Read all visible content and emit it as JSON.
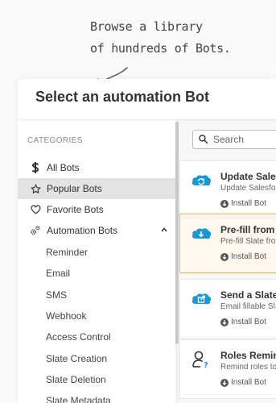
{
  "annotation": {
    "line1": "Browse a library",
    "line2": "of hundreds of Bots."
  },
  "modal": {
    "title": "Select an automation Bot"
  },
  "sidebar": {
    "categories_label": "CATEGORIES",
    "items": [
      {
        "label": "All Bots",
        "icon": "dollar-icon",
        "selected": false
      },
      {
        "label": "Popular Bots",
        "icon": "star-icon",
        "selected": true
      },
      {
        "label": "Favorite Bots",
        "icon": "heart-icon",
        "selected": false
      },
      {
        "label": "Automation Bots",
        "icon": "gears-icon",
        "selected": false,
        "expanded": true
      }
    ],
    "subitems": [
      "Reminder",
      "Email",
      "SMS",
      "Webhook",
      "Access Control",
      "Slate Creation",
      "Slate Deletion",
      "Slate Metadata"
    ]
  },
  "search": {
    "placeholder": "Search",
    "value": ""
  },
  "bots": [
    {
      "title": "Update Sales",
      "description": "Update Salesfo",
      "install_label": "Install Bot",
      "icon": "salesforce-sync-icon",
      "highlighted": false
    },
    {
      "title": "Pre-fill from",
      "description": "Pre-fill Slate fro",
      "install_label": "Install Bot",
      "icon": "salesforce-download-icon",
      "highlighted": true
    },
    {
      "title": "Send a Slate",
      "description": "Email fillable Sl",
      "install_label": "Install Bot",
      "icon": "salesforce-share-icon",
      "highlighted": false
    },
    {
      "title": "Roles Remin",
      "description": "Remind roles to",
      "install_label": "Install Bot",
      "icon": "user-question-icon",
      "highlighted": false
    }
  ],
  "colors": {
    "accent_highlight_border": "#f2b15a",
    "salesforce_blue": "#1b96d4",
    "selected_bg": "#e3e3e3"
  }
}
